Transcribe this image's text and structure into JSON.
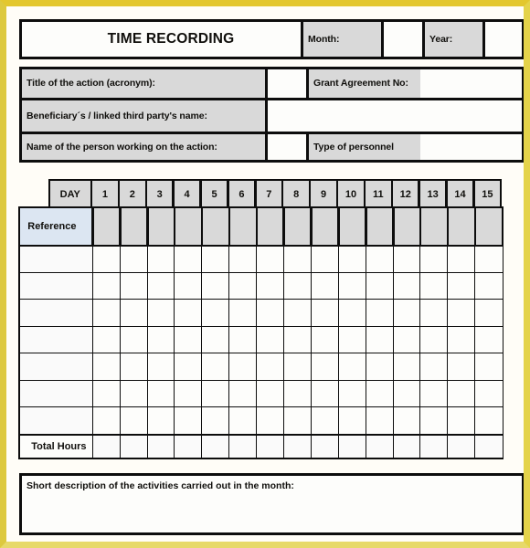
{
  "document": {
    "title": "TIME RECORDING"
  },
  "header": {
    "month_label": "Month:",
    "month_value": "",
    "year_label": "Year:",
    "year_value": ""
  },
  "info_rows": [
    {
      "label": "Title of the action (acronym):",
      "value": "",
      "label2": "Grant Agreement No:",
      "value2": ""
    },
    {
      "label": "Beneficiary´s / linked third party's name:",
      "value": "",
      "label2": "",
      "value2": ""
    },
    {
      "label": "Name of the person working on the action:",
      "value": "",
      "label2": "Type of personnel",
      "value2": ""
    }
  ],
  "grid": {
    "day_label": "DAY",
    "reference_label": "Reference",
    "total_label": "Total Hours",
    "days": [
      "1",
      "2",
      "3",
      "4",
      "5",
      "6",
      "7",
      "8",
      "9",
      "10",
      "11",
      "12",
      "13",
      "14",
      "15"
    ],
    "body_rows": [
      {
        "reference": "",
        "values": [
          "",
          "",
          "",
          "",
          "",
          "",
          "",
          "",
          "",
          "",
          "",
          "",
          "",
          "",
          ""
        ]
      },
      {
        "reference": "",
        "values": [
          "",
          "",
          "",
          "",
          "",
          "",
          "",
          "",
          "",
          "",
          "",
          "",
          "",
          "",
          ""
        ]
      },
      {
        "reference": "",
        "values": [
          "",
          "",
          "",
          "",
          "",
          "",
          "",
          "",
          "",
          "",
          "",
          "",
          "",
          "",
          ""
        ]
      },
      {
        "reference": "",
        "values": [
          "",
          "",
          "",
          "",
          "",
          "",
          "",
          "",
          "",
          "",
          "",
          "",
          "",
          "",
          ""
        ]
      },
      {
        "reference": "",
        "values": [
          "",
          "",
          "",
          "",
          "",
          "",
          "",
          "",
          "",
          "",
          "",
          "",
          "",
          "",
          ""
        ]
      },
      {
        "reference": "",
        "values": [
          "",
          "",
          "",
          "",
          "",
          "",
          "",
          "",
          "",
          "",
          "",
          "",
          "",
          "",
          ""
        ]
      },
      {
        "reference": "",
        "values": [
          "",
          "",
          "",
          "",
          "",
          "",
          "",
          "",
          "",
          "",
          "",
          "",
          "",
          "",
          ""
        ]
      }
    ],
    "total_values": [
      "",
      "",
      "",
      "",
      "",
      "",
      "",
      "",
      "",
      "",
      "",
      "",
      "",
      "",
      ""
    ]
  },
  "description": {
    "label": "Short description of the activities carried out in the month:",
    "value": "",
    "watermark": ""
  },
  "colors": {
    "frame": "#e0cc3c",
    "header_gray": "#d9d9d9",
    "reference_blue": "#dce6f2",
    "border": "#0d0d0d",
    "paper": "#fffdf7"
  }
}
